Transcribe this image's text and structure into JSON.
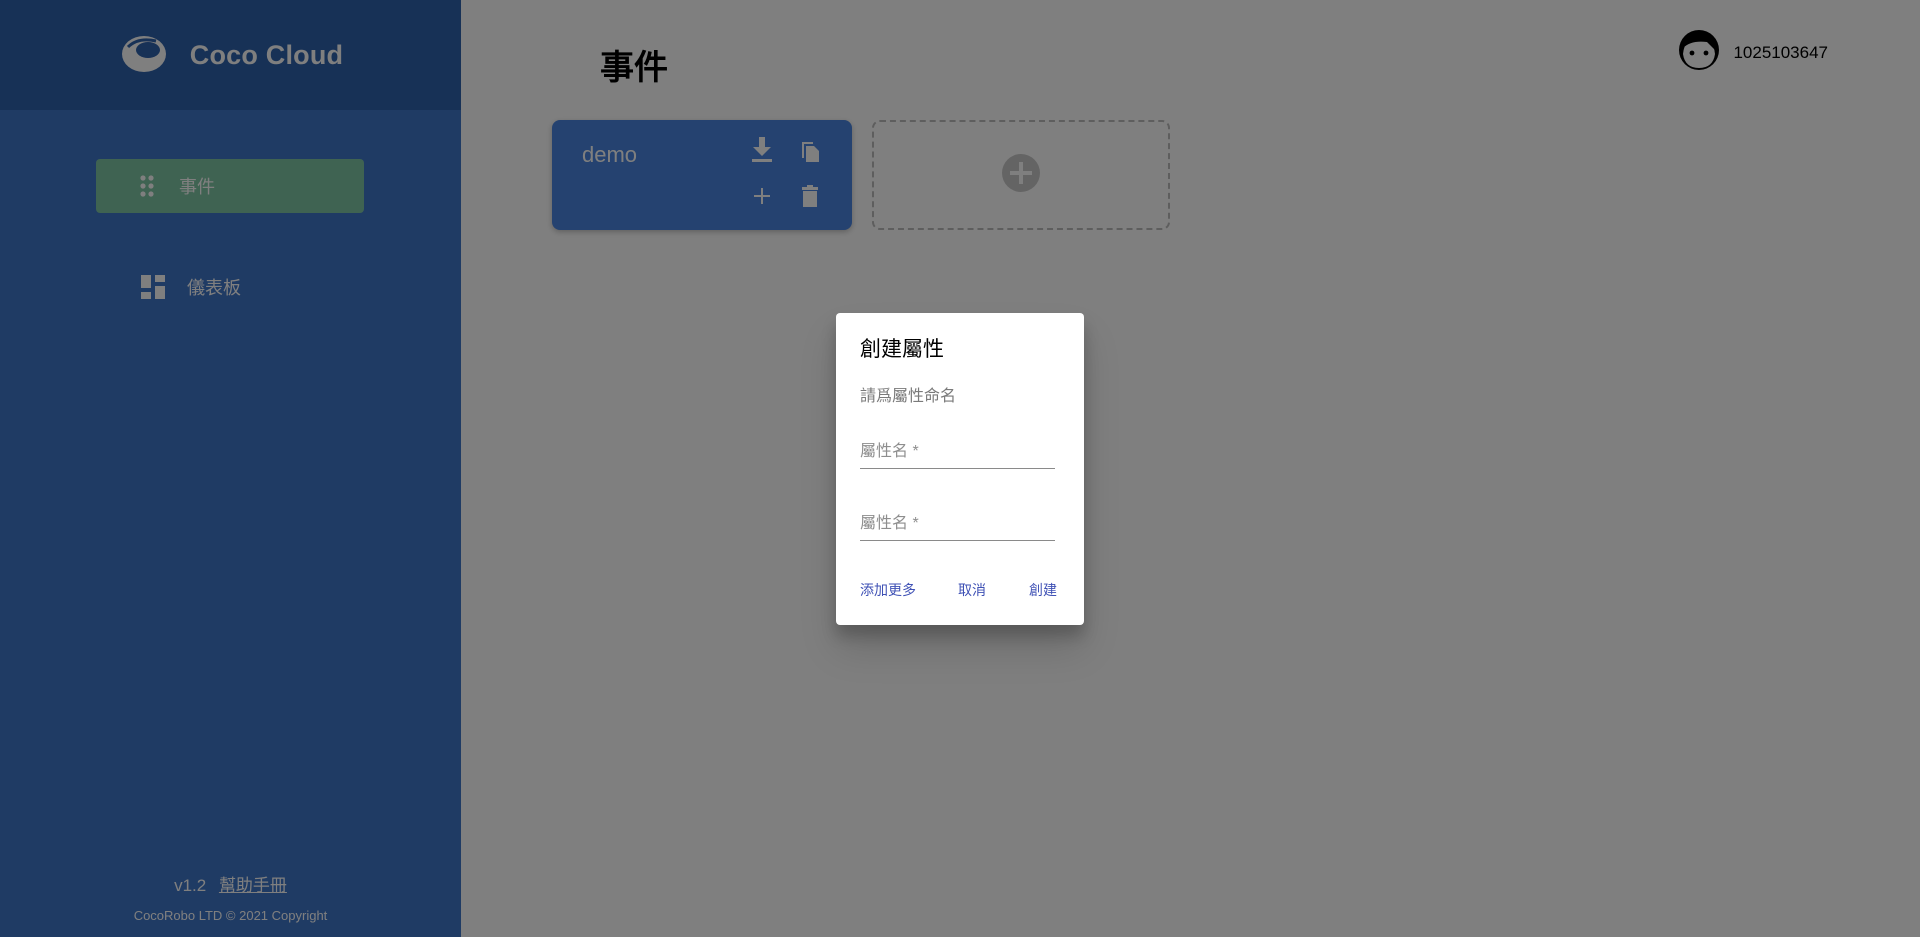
{
  "brand": {
    "name": "Coco Cloud"
  },
  "sidebar": {
    "items": [
      {
        "label": "事件"
      },
      {
        "label": "儀表板"
      }
    ],
    "version": "v1.2",
    "help_link": "幫助手冊",
    "copyright": "CocoRobo LTD © 2021 Copyright"
  },
  "header": {
    "title": "事件",
    "user_id": "1025103647"
  },
  "events": [
    {
      "name": "demo"
    }
  ],
  "dialog": {
    "title": "創建屬性",
    "description": "請爲屬性命名",
    "fields": [
      {
        "placeholder": "屬性名 *",
        "value": ""
      },
      {
        "placeholder": "屬性名 *",
        "value": ""
      }
    ],
    "buttons": {
      "add_more": "添加更多",
      "cancel": "取消",
      "create": "創建"
    }
  },
  "colors": {
    "sidebar": "#3f76c9",
    "sidebar_header": "#2f62ad",
    "active_nav": "#7fc6a4",
    "card": "#4a85e0",
    "dialog_button": "#3f51b5"
  },
  "icons": [
    "cloud-logo-icon",
    "drag-dots-icon",
    "dashboard-icon",
    "user-face-icon",
    "download-icon",
    "copy-icon",
    "add-icon",
    "delete-icon",
    "add-circle-icon"
  ]
}
